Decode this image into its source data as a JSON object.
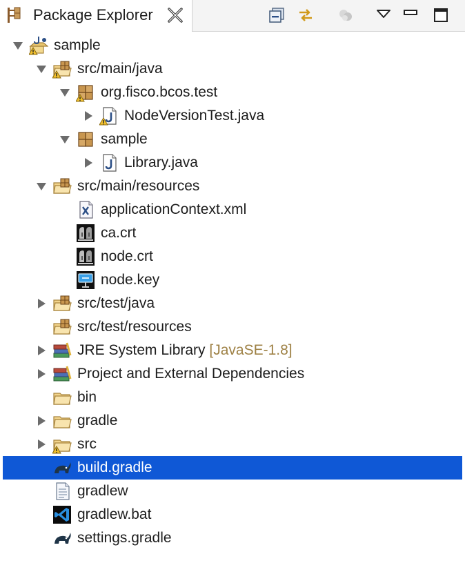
{
  "tab": {
    "title": "Package Explorer",
    "icon": "package-explorer-icon",
    "close_icon": "close-icon"
  },
  "toolbar": [
    {
      "id": "collapse-all",
      "icon": "collapse-all-icon"
    },
    {
      "id": "link-with-editor",
      "icon": "link-with-editor-icon"
    },
    {
      "id": "focus-active-task",
      "icon": "focus-active-task-icon",
      "disabled": true
    },
    {
      "id": "view-menu",
      "icon": "view-menu-icon"
    },
    {
      "id": "minimize",
      "icon": "minimize-icon"
    },
    {
      "id": "maximize",
      "icon": "maximize-icon"
    }
  ],
  "colors": {
    "selection": "#0f58d6",
    "folder": "#f2d48c",
    "decoration_text": "#9e8145",
    "warning": "#f2c12e"
  },
  "tree": [
    {
      "label": "sample",
      "depth": 0,
      "expander": "expanded",
      "icon": "java-project-icon",
      "warning": true
    },
    {
      "label": "src/main/java",
      "depth": 1,
      "expander": "expanded",
      "icon": "source-folder-icon",
      "warning": true
    },
    {
      "label": "org.fisco.bcos.test",
      "depth": 2,
      "expander": "expanded",
      "icon": "package-icon",
      "warning": true
    },
    {
      "label": "NodeVersionTest.java",
      "depth": 3,
      "expander": "collapsed",
      "icon": "java-file-icon",
      "warning": true
    },
    {
      "label": "sample",
      "depth": 2,
      "expander": "expanded",
      "icon": "package-icon",
      "warning": false
    },
    {
      "label": "Library.java",
      "depth": 3,
      "expander": "collapsed",
      "icon": "java-file-icon",
      "warning": false
    },
    {
      "label": "src/main/resources",
      "depth": 1,
      "expander": "expanded",
      "icon": "source-folder-icon",
      "warning": false
    },
    {
      "label": "applicationContext.xml",
      "depth": 2,
      "expander": "none",
      "icon": "xml-file-icon",
      "warning": false
    },
    {
      "label": "ca.crt",
      "depth": 2,
      "expander": "none",
      "icon": "certificate-file-icon",
      "warning": false
    },
    {
      "label": "node.crt",
      "depth": 2,
      "expander": "none",
      "icon": "certificate-file-icon",
      "warning": false
    },
    {
      "label": "node.key",
      "depth": 2,
      "expander": "none",
      "icon": "keynote-file-icon",
      "warning": false
    },
    {
      "label": "src/test/java",
      "depth": 1,
      "expander": "collapsed",
      "icon": "source-folder-icon",
      "warning": false
    },
    {
      "label": "src/test/resources",
      "depth": 1,
      "expander": "none",
      "icon": "source-folder-icon",
      "warning": false
    },
    {
      "label": "JRE System Library",
      "decoration": "[JavaSE-1.8]",
      "depth": 1,
      "expander": "collapsed",
      "icon": "library-icon",
      "warning": false
    },
    {
      "label": "Project and External Dependencies",
      "depth": 1,
      "expander": "collapsed",
      "icon": "library-icon",
      "warning": false
    },
    {
      "label": "bin",
      "depth": 1,
      "expander": "none",
      "icon": "folder-icon",
      "warning": false
    },
    {
      "label": "gradle",
      "depth": 1,
      "expander": "collapsed",
      "icon": "folder-icon",
      "warning": false
    },
    {
      "label": "src",
      "depth": 1,
      "expander": "collapsed",
      "icon": "folder-icon",
      "warning": true
    },
    {
      "label": "build.gradle",
      "depth": 1,
      "expander": "none",
      "icon": "gradle-file-icon",
      "warning": false,
      "selected": true
    },
    {
      "label": "gradlew",
      "depth": 1,
      "expander": "none",
      "icon": "text-file-icon",
      "warning": false
    },
    {
      "label": "gradlew.bat",
      "depth": 1,
      "expander": "none",
      "icon": "vscode-file-icon",
      "warning": false
    },
    {
      "label": "settings.gradle",
      "depth": 1,
      "expander": "none",
      "icon": "gradle-file-icon",
      "warning": false
    }
  ]
}
